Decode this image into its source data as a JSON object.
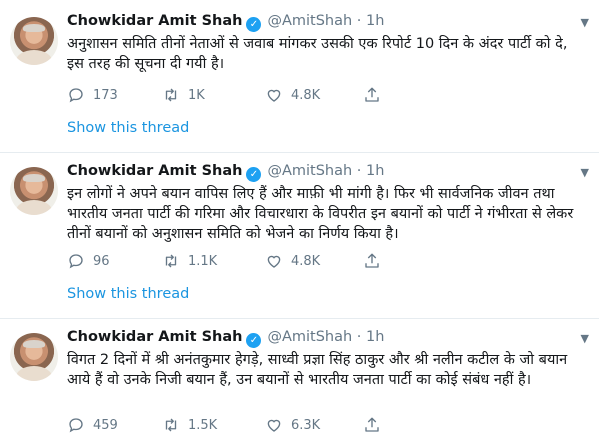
{
  "tweets": [
    {
      "name": "Chowkidar Amit Shah",
      "handle": "@AmitShah",
      "time": "1h",
      "text": "अनुशासन समिति तीनों नेताओं से जवाब मांगकर उसकी एक रिपोर्ट 10 दिन के अंदर पार्टी को दे, इस तरह की सूचना दी गयी है।",
      "replies": "173",
      "retweets": "1K",
      "likes": "4.8K",
      "show_thread": "Show this thread"
    },
    {
      "name": "Chowkidar Amit Shah",
      "handle": "@AmitShah",
      "time": "1h",
      "text": "इन लोगों ने अपने बयान वापिस लिए हैं और माफ़ी भी मांगी है। फिर भी सार्वजनिक जीवन तथा भारतीय जनता पार्टी की गरिमा और विचारधारा के विपरीत इन बयानों को पार्टी ने गंभीरता से लेकर तीनों बयानों को अनुशासन समिति को भेजने का निर्णय किया है।",
      "replies": "96",
      "retweets": "1.1K",
      "likes": "4.8K",
      "show_thread": "Show this thread"
    },
    {
      "name": "Chowkidar Amit Shah",
      "handle": "@AmitShah",
      "time": "1h",
      "text": "विगत 2 दिनों में श्री अनंतकुमार हेगड़े, साध्वी प्रज्ञा सिंह ठाकुर और श्री नलीन कटील के जो बयान आये हैं वो उनके निजी बयान हैं, उन बयानों से भारतीय जनता पार्टी का कोई संबंध नहीं है।",
      "replies": "459",
      "retweets": "1.5K",
      "likes": "6.3K"
    }
  ],
  "icons": {
    "verified": "verified-badge-icon",
    "reply": "reply-icon",
    "retweet": "retweet-icon",
    "like": "heart-icon",
    "share": "share-icon",
    "caret": "chevron-down-icon"
  },
  "colors": {
    "link": "#1b95e0",
    "verified": "#1da1f2",
    "muted": "#657786",
    "text": "#14171a"
  }
}
